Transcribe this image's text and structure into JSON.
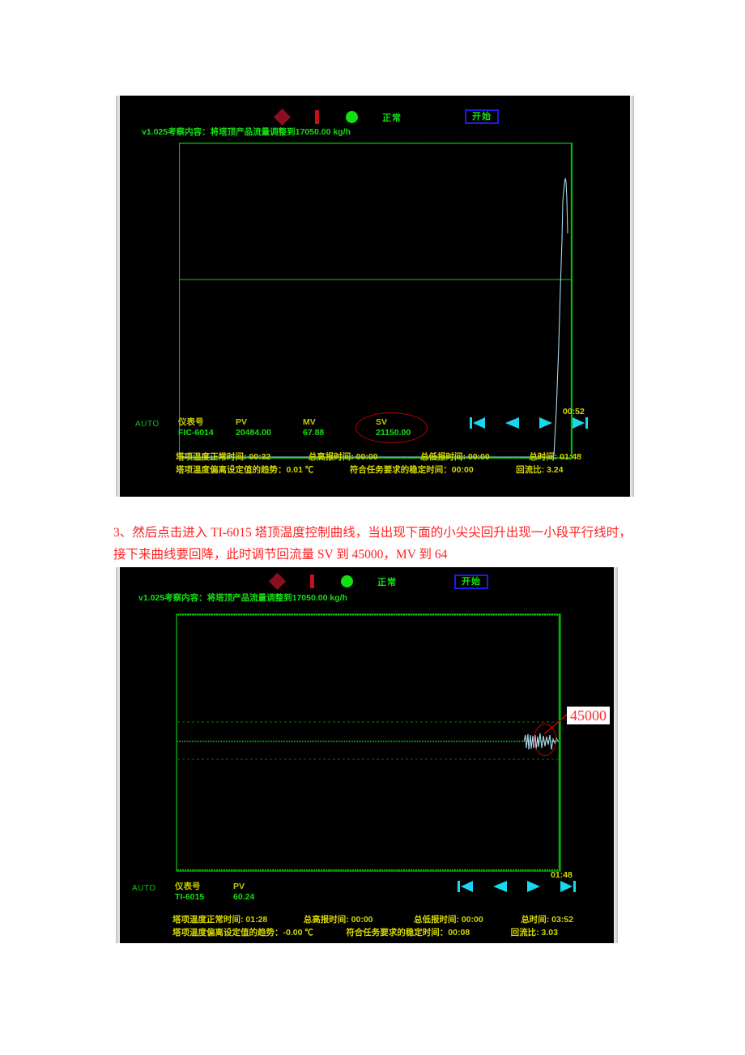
{
  "document": {
    "paragraph_prefix": "3、然后点击进入 ",
    "paragraph_inst1": "TI-6015",
    "paragraph_mid1": " 塔顶温度控制曲线，当出现下面的小尖尖回升出现一小段平行线时，接下来曲线要回降，此时调节回流量 ",
    "paragraph_sv": "SV",
    "paragraph_mid2": " 到 ",
    "paragraph_sv_value": "45000",
    "paragraph_mid3": "，",
    "paragraph_mv": "MV",
    "paragraph_mid4": " 到 ",
    "paragraph_mv_value": "64",
    "paragraph_full": "3、然后点击进入 TI-6015 塔顶温度控制曲线，当出现下面的小尖尖回升出现一小段平行线时，接下来曲线要回降，此时调节回流量 SV 到 45000，MV 到 64"
  },
  "colors": {
    "green": "#12e012",
    "yellow": "#c8c800",
    "cyan": "#18d8f0",
    "red_anno": "#c00000",
    "blue_border": "#1b1bee",
    "background": "#000000"
  },
  "screenshot1": {
    "header": {
      "icons": [
        "diamond-alarm-icon",
        "bar-alarm-icon",
        "circle-status-icon"
      ],
      "status_label": "正常",
      "start_button": "开始",
      "task_line": "v1.025考察内容：将塔顶产品流量调整到17050.00 kg/h"
    },
    "chart": {
      "type": "line",
      "curve_color": "#a8d8e8",
      "grid_color": "#0a8a0a",
      "border_color": "#0ab80a"
    },
    "footer": {
      "mode": "AUTO",
      "fields": [
        {
          "label": "仪表号",
          "value": "FIC-6014"
        },
        {
          "label": "PV",
          "value": "20484.00"
        },
        {
          "label": "MV",
          "value": "67.88"
        },
        {
          "label": "SV",
          "value": "21150.00"
        }
      ],
      "nav": [
        "skip-back-icon",
        "rewind-icon",
        "play-icon",
        "skip-forward-icon"
      ],
      "clock": "00:52",
      "stats_row1": [
        "塔项温度正常时间: 00:32",
        "总高报时间: 00:00",
        "总低报时间: 00:00",
        "总时间: 01:48"
      ],
      "stats_row2": [
        "塔项温度偏离设定值的趋势：0.01 ℃",
        "符合任务要求的稳定时间：00:00",
        "回流比: 3.24"
      ]
    },
    "annotation": {
      "type": "ellipse",
      "target": "SV 21150.00"
    }
  },
  "screenshot2": {
    "header": {
      "icons": [
        "diamond-alarm-icon",
        "bar-alarm-icon",
        "circle-status-icon"
      ],
      "status_label": "正常",
      "start_button": "开始",
      "task_line": "v1.025考察内容：将塔顶产品流量调整到17050.00 kg/h"
    },
    "chart": {
      "type": "line",
      "curve_color": "#a8d8e8",
      "grid_color": "#0a8a0a",
      "border_color": "#0ab80a",
      "setpoint_line": true
    },
    "footer": {
      "mode": "AUTO",
      "fields": [
        {
          "label": "仪表号",
          "value": "TI-6015"
        },
        {
          "label": "PV",
          "value": "60.24"
        }
      ],
      "nav": [
        "skip-back-icon",
        "rewind-icon",
        "play-icon",
        "skip-forward-icon"
      ],
      "clock": "01:48",
      "stats_row1": [
        "塔项温度正常时间: 01:28",
        "总高报时间: 00:00",
        "总低报时间: 00:00",
        "总时间: 03:52"
      ],
      "stats_row2": [
        "塔项温度偏离设定值的趋势：-0.00 ℃",
        "符合任务要求的稳定时间：00:08",
        "回流比: 3.03"
      ]
    },
    "annotation": {
      "type": "callout",
      "label": "45000",
      "target": "curve-tail"
    }
  }
}
